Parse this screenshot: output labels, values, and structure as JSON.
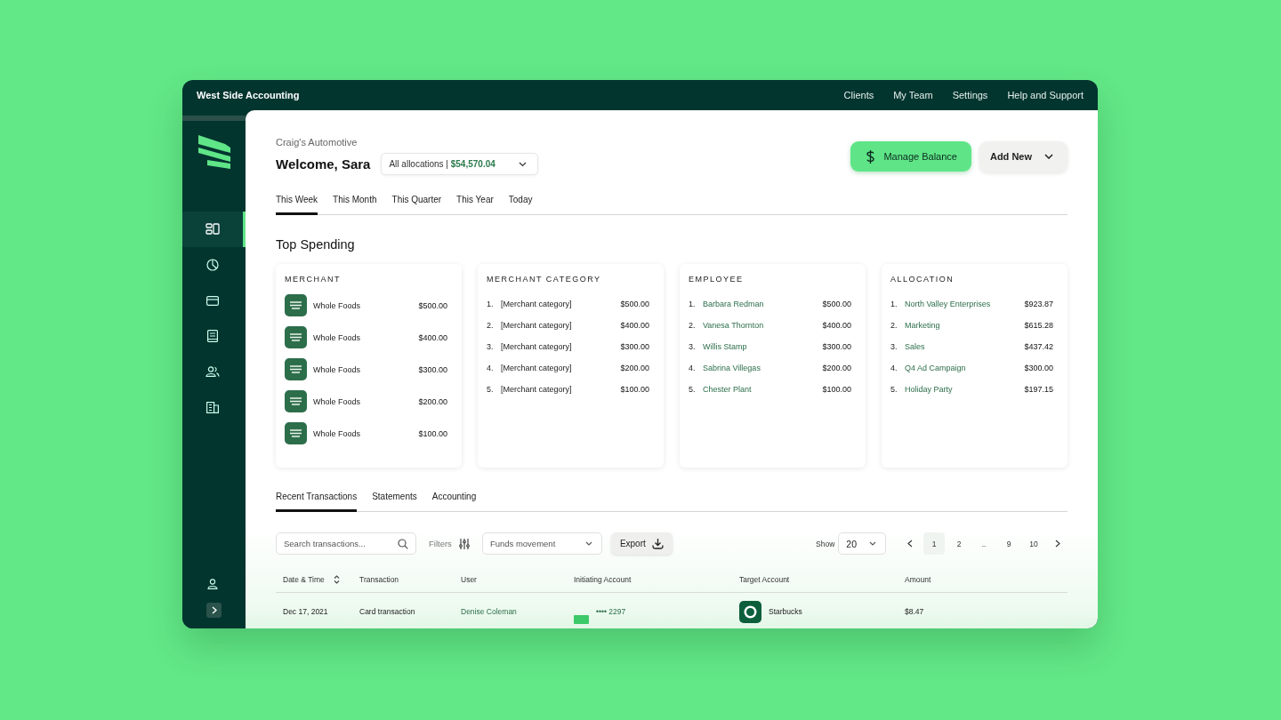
{
  "app": {
    "title": "West Side Accounting"
  },
  "top_nav": [
    {
      "label": "Clients"
    },
    {
      "label": "My Team"
    },
    {
      "label": "Settings"
    },
    {
      "label": "Help and Support"
    }
  ],
  "sidebar": {
    "items": [
      {
        "kind": "dashboard",
        "selected": true
      },
      {
        "kind": "chart",
        "selected": false
      },
      {
        "kind": "card",
        "selected": false
      },
      {
        "kind": "book",
        "selected": false
      },
      {
        "kind": "people",
        "selected": false
      },
      {
        "kind": "building",
        "selected": false
      }
    ],
    "bottom_items": [
      {
        "kind": "user"
      },
      {
        "kind": "expand"
      }
    ]
  },
  "header": {
    "company": "Craig's Automotive",
    "greeting": "Welcome, Sara",
    "allocation_select": {
      "label": "All allocations",
      "separator": "|",
      "amount": "$54,570.04"
    },
    "buttons": [
      {
        "kind": "primary",
        "label": "Manage Balance"
      },
      {
        "kind": "dropdown",
        "label": "Add New"
      }
    ]
  },
  "period_tabs": [
    {
      "label": "This Week",
      "selected": true
    },
    {
      "label": "This Month",
      "selected": false
    },
    {
      "label": "This Quarter",
      "selected": false
    },
    {
      "label": "This Year",
      "selected": false
    },
    {
      "label": "Today",
      "selected": false
    }
  ],
  "top_spending": {
    "title": "Top Spending",
    "cards": [
      {
        "title": "MERCHANT",
        "kind": "logo",
        "rows": [
          {
            "name": "Whole Foods",
            "amount": "$500.00"
          },
          {
            "name": "Whole Foods",
            "amount": "$400.00"
          },
          {
            "name": "Whole Foods",
            "amount": "$300.00"
          },
          {
            "name": "Whole Foods",
            "amount": "$200.00"
          },
          {
            "name": "Whole Foods",
            "amount": "$100.00"
          }
        ]
      },
      {
        "title": "MERCHANT CATEGORY",
        "kind": "ranked",
        "rows": [
          {
            "rank": "1.",
            "name": "[Merchant category]",
            "amount": "$500.00"
          },
          {
            "rank": "2.",
            "name": "[Merchant category]",
            "amount": "$400.00"
          },
          {
            "rank": "3.",
            "name": "[Merchant category]",
            "amount": "$300.00"
          },
          {
            "rank": "4.",
            "name": "[Merchant category]",
            "amount": "$200.00"
          },
          {
            "rank": "5.",
            "name": "[Merchant category]",
            "amount": "$100.00"
          }
        ]
      },
      {
        "title": "EMPLOYEE",
        "kind": "ranked_link",
        "rows": [
          {
            "rank": "1.",
            "name": "Barbara Redman",
            "amount": "$500.00"
          },
          {
            "rank": "2.",
            "name": "Vanesa Thornton",
            "amount": "$400.00"
          },
          {
            "rank": "3.",
            "name": "Willis Stamp",
            "amount": "$300.00"
          },
          {
            "rank": "4.",
            "name": "Sabrina Villegas",
            "amount": "$200.00"
          },
          {
            "rank": "5.",
            "name": "Chester Plant",
            "amount": "$100.00"
          }
        ]
      },
      {
        "title": "ALLOCATION",
        "kind": "ranked_link",
        "rows": [
          {
            "rank": "1.",
            "name": "North Valley Enterprises",
            "amount": "$923.87"
          },
          {
            "rank": "2.",
            "name": "Marketing",
            "amount": "$615.28"
          },
          {
            "rank": "3.",
            "name": "Sales",
            "amount": "$437.42"
          },
          {
            "rank": "4.",
            "name": "Q4 Ad Campaign",
            "amount": "$300.00"
          },
          {
            "rank": "5.",
            "name": "Holiday Party",
            "amount": "$197.15"
          }
        ]
      }
    ]
  },
  "transaction_tabs": [
    {
      "label": "Recent Transactions",
      "selected": true
    },
    {
      "label": "Statements",
      "selected": false
    },
    {
      "label": "Accounting",
      "selected": false
    }
  ],
  "toolbar": {
    "search": {
      "placeholder": "Search transactions..."
    },
    "filters": "Filters",
    "funds_select": "Funds movement",
    "export": "Export",
    "show_label": "Show",
    "show_value": "20",
    "pages": [
      {
        "label": "1",
        "selected": true
      },
      {
        "label": "2",
        "selected": false
      },
      {
        "label": "..",
        "selected": false
      },
      {
        "label": "9",
        "selected": false
      },
      {
        "label": "10",
        "selected": false
      }
    ]
  },
  "table": {
    "columns": [
      {
        "label": "Date & Time",
        "sortable": true
      },
      {
        "label": "Transaction",
        "sortable": false
      },
      {
        "label": "User",
        "sortable": false
      },
      {
        "label": "Initiating Account",
        "sortable": false
      },
      {
        "label": "Target Account",
        "sortable": false
      },
      {
        "label": "Amount",
        "sortable": false
      }
    ],
    "rows": [
      {
        "date": "Dec 17, 2021",
        "transaction": "Card transaction",
        "user": "Denise Coleman",
        "initiating_account": "•••• 2297",
        "target_account": "Starbucks",
        "amount": "$8.47"
      }
    ]
  }
}
